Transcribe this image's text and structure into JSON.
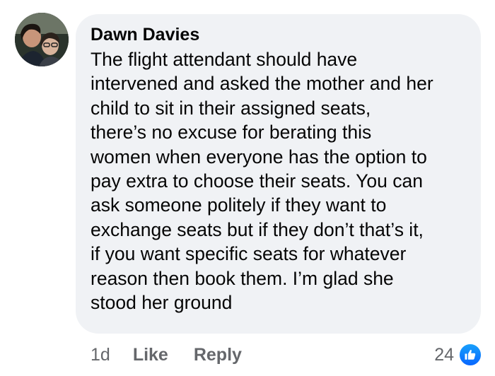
{
  "comment": {
    "author": "Dawn Davies",
    "text": "The flight attendant should have\nintervened and asked the mother and her\nchild to sit in their assigned seats,\nthere’s no excuse for berating this\nwomen when everyone has the option to\npay extra to choose their seats. You can\nask someone politely if they want to\nexchange seats but if they don’t that’s it,\nif you want specific seats for whatever\nreason then book them. I’m glad she\nstood her ground",
    "timestamp": "1d",
    "like_label": "Like",
    "reply_label": "Reply",
    "reaction_count": "24",
    "reaction_icon": "like-thumb-icon"
  },
  "colors": {
    "bubble": "#f0f2f5",
    "text": "#050505",
    "secondary_text": "#65676b",
    "like_blue": "#0866ff"
  }
}
